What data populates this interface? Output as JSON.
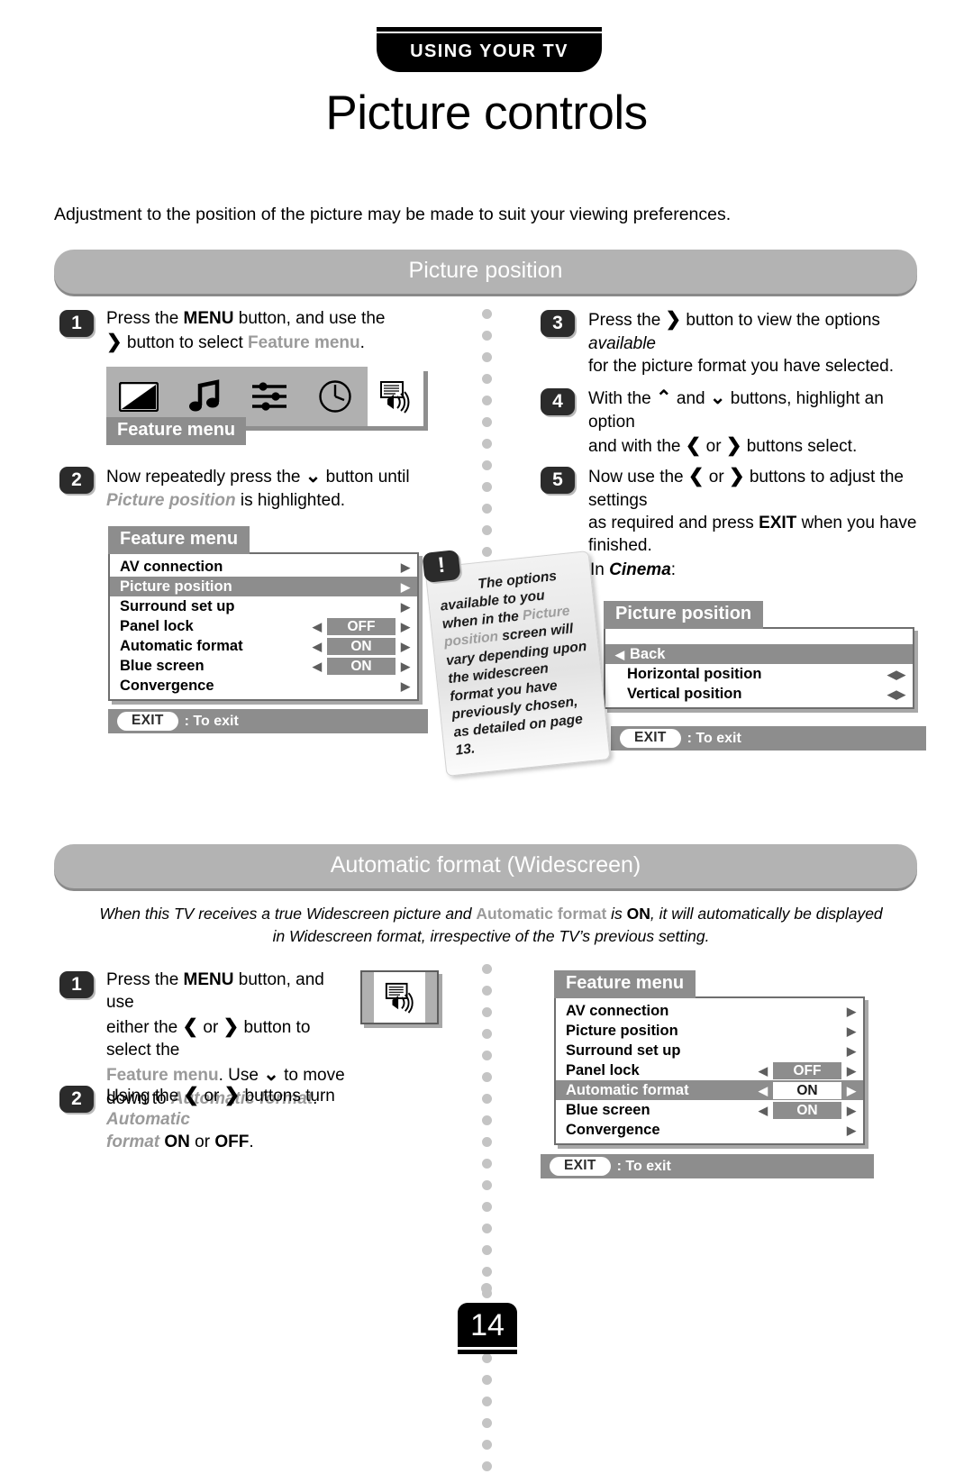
{
  "header": {
    "banner": "USING YOUR TV",
    "title": "Picture controls"
  },
  "intro": "Adjustment to the position of the picture may be made to suit your viewing preferences.",
  "sections": {
    "picture_position": {
      "pill_label": "Picture position",
      "steps": [
        {
          "num": "1",
          "line1_a": "Press the ",
          "line1_b": "MENU",
          "line1_c": " button, and use the",
          "line2_arrow": "❯",
          "line2_a": " button to select ",
          "line2_b": "Feature menu",
          "line2_c": "."
        },
        {
          "num": "2",
          "line1_a": "Now repeatedly press the ",
          "line1_arrow": "⌄",
          "line1_b": " button until",
          "line2_a": "Picture position",
          "line2_b": " is highlighted."
        },
        {
          "num": "3",
          "line1_a": "Press the ",
          "line1_arrow": "❯",
          "line1_b": " button to view the options ",
          "line1_i": "available",
          "line2": "for the picture format you have selected."
        },
        {
          "num": "4",
          "line1_a": "With the ",
          "line1_up": "⌃",
          "line1_b": " and ",
          "line1_down": "⌄",
          "line1_c": " buttons, highlight an option",
          "line2_a": "and with the ",
          "line2_l": "❮",
          "line2_b": " or ",
          "line2_r": "❯",
          "line2_c": " buttons select."
        },
        {
          "num": "5",
          "line1_a": "Now use the ",
          "line1_l": "❮",
          "line1_b": " or ",
          "line1_r": "❯",
          "line1_c": " buttons to adjust the settings",
          "line2_a": "as required and press ",
          "line2_b": "EXIT",
          "line2_c": " when you have",
          "line3": "finished."
        }
      ],
      "iconbar": {
        "icons": [
          "contrast-icon",
          "music-note-icon",
          "sliders-icon",
          "clock-icon",
          "feature-screen-speaker-icon"
        ],
        "selected_index": 4,
        "tab_label": "Feature menu"
      },
      "feature_menu": {
        "title": "Feature menu",
        "rows": [
          {
            "label": "AV connection",
            "value": null,
            "highlighted": false,
            "has_arrow": true
          },
          {
            "label": "Picture position",
            "value": null,
            "highlighted": true,
            "has_arrow": true
          },
          {
            "label": "Surround set up",
            "value": null,
            "highlighted": false,
            "has_arrow": true
          },
          {
            "label": "Panel lock",
            "value": "OFF",
            "highlighted": false,
            "has_arrow": true
          },
          {
            "label": "Automatic format",
            "value": "ON",
            "highlighted": false,
            "has_arrow": true
          },
          {
            "label": "Blue screen",
            "value": "ON",
            "highlighted": false,
            "has_arrow": true
          },
          {
            "label": "Convergence",
            "value": null,
            "highlighted": false,
            "has_arrow": true
          }
        ],
        "exit_key": "EXIT",
        "exit_text": ": To exit"
      },
      "note": {
        "badge": "!",
        "text_1": "The options available to you when in the ",
        "text_grey": "Picture position",
        "text_2": " screen will vary depending upon the widescreen format you have previously chosen, as detailed on page 13."
      },
      "cinema": {
        "prefix": "In ",
        "word": "Cinema",
        "suffix": ":"
      },
      "picture_position_menu": {
        "title": "Picture position",
        "rows": [
          {
            "label": "Back",
            "highlighted": true,
            "back_arrow": true,
            "lr_arrows": false
          },
          {
            "label": "Horizontal position",
            "highlighted": false,
            "back_arrow": false,
            "lr_arrows": true
          },
          {
            "label": "Vertical position",
            "highlighted": false,
            "back_arrow": false,
            "lr_arrows": true
          }
        ],
        "exit_key": "EXIT",
        "exit_text": ": To exit"
      }
    },
    "automatic_format": {
      "pill_label": "Automatic format (Widescreen)",
      "description_1": "When this TV receives a true Widescreen picture and ",
      "description_grey": "Automatic format",
      "description_2": " is ",
      "description_bold": "ON",
      "description_3": ", it will automatically be displayed",
      "description_line2": "in Widescreen format, irrespective of the TV’s previous setting.",
      "steps": [
        {
          "num": "1",
          "line1_a": "Press the ",
          "line1_b": "MENU",
          "line1_c": " button, and use",
          "line2_a": "either the ",
          "line2_l": "❮",
          "line2_b": " or ",
          "line2_r": "❯",
          "line2_c": " button to select the",
          "line3_a": "Feature menu",
          "line3_b": ". Use ",
          "line3_down": "⌄",
          "line3_c": " to move",
          "line4_a": "down to ",
          "line4_b": "Automatic format",
          "line4_c": "."
        },
        {
          "num": "2",
          "line1_a": "Using the ",
          "line1_l": "❮",
          "line1_b": " or ",
          "line1_r": "❯",
          "line1_c": " buttons turn ",
          "line1_d": "Automatic",
          "line2_a": "format",
          "line2_b": " ON",
          "line2_c": " or ",
          "line2_d": "OFF",
          "line2_e": "."
        }
      ],
      "tv_icon": "feature-screen-speaker-icon",
      "feature_menu": {
        "title": "Feature menu",
        "rows": [
          {
            "label": "AV connection",
            "value": null,
            "highlighted": false,
            "has_arrow": true
          },
          {
            "label": "Picture position",
            "value": null,
            "highlighted": false,
            "has_arrow": true
          },
          {
            "label": "Surround set up",
            "value": null,
            "highlighted": false,
            "has_arrow": true
          },
          {
            "label": "Panel lock",
            "value": "OFF",
            "highlighted": false,
            "has_arrow": true
          },
          {
            "label": "Automatic format",
            "value": "ON",
            "highlighted": true,
            "has_arrow": true
          },
          {
            "label": "Blue screen",
            "value": "ON",
            "highlighted": false,
            "has_arrow": true
          },
          {
            "label": "Convergence",
            "value": null,
            "highlighted": false,
            "has_arrow": true
          }
        ],
        "exit_key": "EXIT",
        "exit_text": ": To exit"
      }
    }
  },
  "page_number": "14",
  "colors": {
    "grey_bar": "#8d8d8d",
    "pill": "#b3b3b3",
    "badge": "#2b2b2b",
    "dot": "#c4c4c4"
  }
}
